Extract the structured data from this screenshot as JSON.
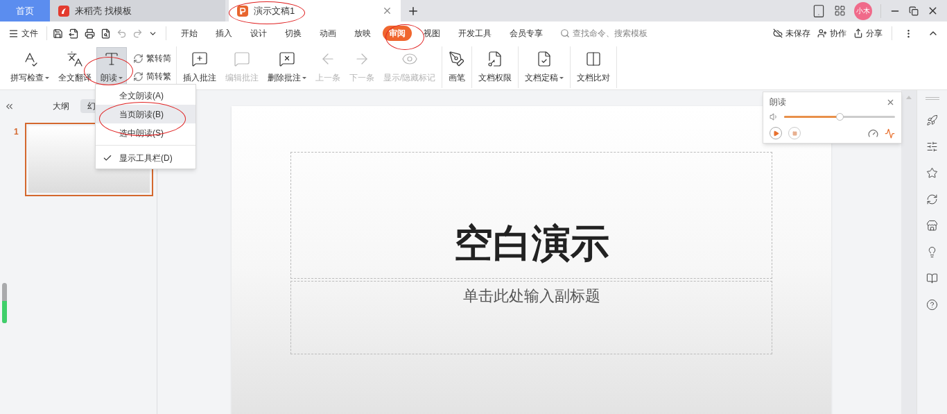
{
  "title_bar": {
    "tabs": [
      {
        "label": "首页",
        "kind": "home",
        "selected": false
      },
      {
        "label": "来稻壳 找模板",
        "kind": "docer",
        "selected": false
      },
      {
        "label": "演示文稿1",
        "kind": "doc",
        "selected": true
      }
    ],
    "avatar": "小木"
  },
  "menu_bar": {
    "file": "文件",
    "tabs": [
      {
        "label": "开始",
        "selected": false
      },
      {
        "label": "插入",
        "selected": false
      },
      {
        "label": "设计",
        "selected": false
      },
      {
        "label": "切换",
        "selected": false
      },
      {
        "label": "动画",
        "selected": false
      },
      {
        "label": "放映",
        "selected": false
      },
      {
        "label": "审阅",
        "selected": true
      },
      {
        "label": "视图",
        "selected": false
      },
      {
        "label": "开发工具",
        "selected": false
      },
      {
        "label": "会员专享",
        "selected": false
      }
    ],
    "search": {
      "placeholder": "查找命令、搜索模板"
    },
    "actions": [
      "未保存",
      "协作",
      "分享"
    ]
  },
  "ribbon": {
    "groups": [
      [
        {
          "label": "拼写检查",
          "kind": "large",
          "dropdown": true,
          "disabled": false,
          "pressed": false
        },
        {
          "label": "全文翻译",
          "kind": "large",
          "dropdown": false,
          "disabled": false,
          "pressed": false
        },
        {
          "label": "朗读",
          "kind": "large",
          "dropdown": true,
          "disabled": false,
          "pressed": true
        },
        {
          "label": "繁转简",
          "kind": "small"
        },
        {
          "label": "简转繁",
          "kind": "small"
        }
      ],
      [
        {
          "label": "插入批注",
          "kind": "large",
          "dropdown": false,
          "disabled": false,
          "pressed": false
        },
        {
          "label": "编辑批注",
          "kind": "large",
          "dropdown": false,
          "disabled": true,
          "pressed": false
        },
        {
          "label": "删除批注",
          "kind": "large",
          "dropdown": true,
          "disabled": false,
          "pressed": false
        },
        {
          "label": "上一条",
          "kind": "large",
          "dropdown": false,
          "disabled": true,
          "pressed": false
        },
        {
          "label": "下一条",
          "kind": "large",
          "dropdown": false,
          "disabled": true,
          "pressed": false
        },
        {
          "label": "显示/隐藏标记",
          "kind": "large",
          "dropdown": false,
          "disabled": true,
          "pressed": false
        }
      ],
      [
        {
          "label": "画笔",
          "kind": "large",
          "dropdown": false,
          "disabled": false,
          "pressed": false
        }
      ],
      [
        {
          "label": "文档权限",
          "kind": "large",
          "dropdown": false,
          "disabled": false,
          "pressed": false
        }
      ],
      [
        {
          "label": "文档定稿",
          "kind": "large",
          "dropdown": true,
          "disabled": false,
          "pressed": false
        }
      ],
      [
        {
          "label": "文档比对",
          "kind": "large",
          "dropdown": false,
          "disabled": false,
          "pressed": false
        }
      ]
    ]
  },
  "dropdown_menu": {
    "items": [
      {
        "label": "全文朗读(A)",
        "selected": false
      },
      {
        "label": "当页朗读(B)",
        "selected": true
      },
      {
        "label": "选中朗读(S)",
        "selected": false
      }
    ],
    "toggles": [
      {
        "label": "显示工具栏(D)",
        "checked": true
      }
    ]
  },
  "slide_panel": {
    "tabs": [
      {
        "label": "大纲",
        "selected": false
      },
      {
        "label": "幻",
        "selected": true
      }
    ],
    "slides": [
      {
        "number": "1",
        "selected": true
      }
    ]
  },
  "slide": {
    "title": "空白演示",
    "subtitle": "单击此处输入副标题"
  },
  "reading_panel": {
    "title": "朗读",
    "volume": {
      "level": 0.5
    }
  },
  "level_meter": {
    "level": 0.55
  }
}
